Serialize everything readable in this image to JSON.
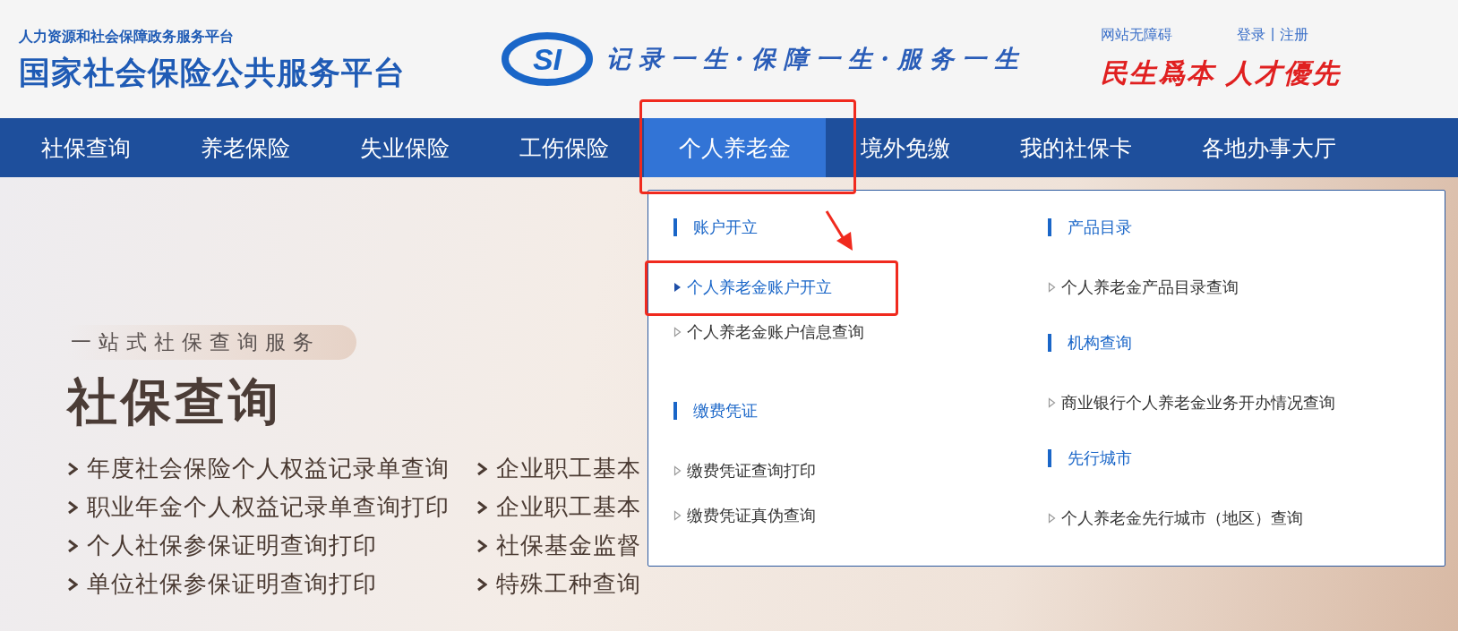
{
  "header": {
    "subtitle": "人力资源和社会保障政务服务平台",
    "title": "国家社会保险公共服务平台",
    "logo_text": "SI",
    "slogan": "记录一生·保障一生·服务一生",
    "accessibility_link": "网站无障碍",
    "login": "登录",
    "separator": "|",
    "register": "注册",
    "motto": "民生爲本 人才優先"
  },
  "nav": [
    {
      "label": "社保查询",
      "selected": false
    },
    {
      "label": "养老保险",
      "selected": false
    },
    {
      "label": "失业保险",
      "selected": false
    },
    {
      "label": "工伤保险",
      "selected": false
    },
    {
      "label": "个人养老金",
      "selected": true
    },
    {
      "label": "境外免缴",
      "selected": false
    },
    {
      "label": "我的社保卡",
      "selected": false
    },
    {
      "label": "各地办事大厅",
      "selected": false
    }
  ],
  "banner": {
    "tagline": "一站式社保查询服务",
    "title": "社保查询",
    "links": [
      [
        "年度社会保险个人权益记录单查询",
        "职业年金个人权益记录单查询打印",
        "个人社保参保证明查询打印",
        "单位社保参保证明查询打印"
      ],
      [
        "企业职工基本",
        "企业职工基本",
        "社保基金监督",
        "特殊工种查询"
      ]
    ]
  },
  "dropdown": {
    "columns": [
      {
        "groups": [
          {
            "heading": "账户开立",
            "items": [
              {
                "label": "个人养老金账户开立",
                "selected": true
              },
              {
                "label": "个人养老金账户信息查询",
                "selected": false
              }
            ]
          },
          {
            "heading": "缴费凭证",
            "items": [
              {
                "label": "缴费凭证查询打印",
                "selected": false
              },
              {
                "label": "缴费凭证真伪查询",
                "selected": false
              }
            ]
          }
        ]
      },
      {
        "groups": [
          {
            "heading": "产品目录",
            "items": [
              {
                "label": "个人养老金产品目录查询",
                "selected": false
              }
            ]
          },
          {
            "heading": "机构查询",
            "items": [
              {
                "label": "商业银行个人养老金业务开办情况查询",
                "selected": false
              }
            ]
          },
          {
            "heading": "先行城市",
            "items": [
              {
                "label": "个人养老金先行城市（地区）查询",
                "selected": false
              }
            ]
          }
        ]
      }
    ]
  }
}
